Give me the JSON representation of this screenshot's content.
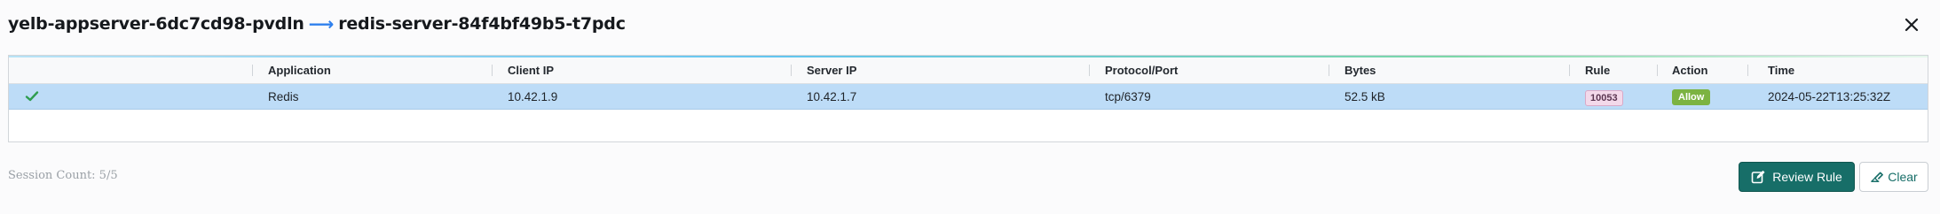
{
  "header": {
    "source": "yelb-appserver-6dc7cd98-pvdln",
    "arrow": "⟶",
    "destination": "redis-server-84f4bf49b5-t7pdc"
  },
  "table": {
    "columns": [
      "Application",
      "Client IP",
      "Server IP",
      "Protocol/Port",
      "Bytes",
      "Rule",
      "Action",
      "Time"
    ],
    "rows": [
      {
        "status_icon": "check-icon",
        "application": "Redis",
        "client_ip": "10.42.1.9",
        "server_ip": "10.42.1.7",
        "protocol_port": "tcp/6379",
        "bytes": "52.5 kB",
        "rule": "10053",
        "action": "Allow",
        "time": "2024-05-22T13:25:32Z"
      }
    ]
  },
  "footer": {
    "session_count": "Session Count: 5/5",
    "review_rule_label": "Review Rule",
    "clear_label": "Clear"
  },
  "colors": {
    "selected_row": "#bddcf7",
    "primary": "#176e68",
    "allow": "#7cb342",
    "rule_badge_bg": "#f3d9ea",
    "check": "#2e9d4f",
    "arrow": "#2f80ed"
  }
}
